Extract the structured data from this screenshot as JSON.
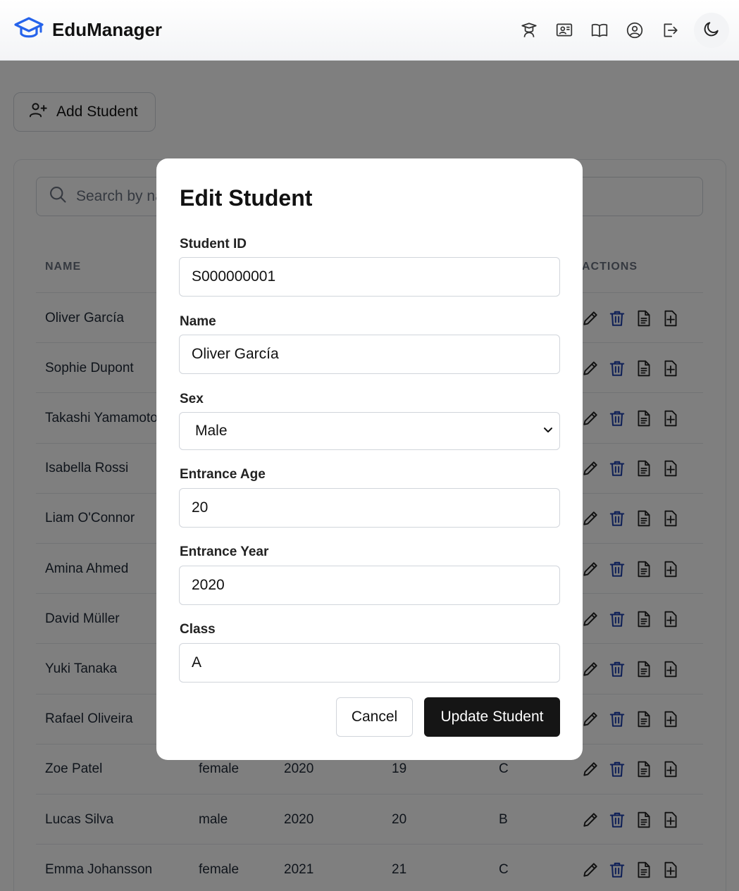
{
  "app": {
    "title": "EduManager"
  },
  "colors": {
    "brand": "#2563eb",
    "delete": "#1e40af"
  },
  "nav": {
    "icons": [
      "graduation-icon",
      "classroom-icon",
      "book-icon",
      "user-circle-icon",
      "logout-icon"
    ],
    "theme_icon": "moon-icon"
  },
  "toolbar": {
    "add_student_label": "Add Student"
  },
  "search": {
    "placeholder": "Search by na"
  },
  "table": {
    "headers": {
      "name": "NAME",
      "actions": "ACTIONS"
    },
    "rows": [
      {
        "name": "Oliver García",
        "sex": "",
        "year": "",
        "age": "",
        "class": ""
      },
      {
        "name": "Sophie Dupont",
        "sex": "",
        "year": "",
        "age": "",
        "class": ""
      },
      {
        "name": "Takashi Yamamoto",
        "sex": "",
        "year": "",
        "age": "",
        "class": ""
      },
      {
        "name": "Isabella Rossi",
        "sex": "",
        "year": "",
        "age": "",
        "class": ""
      },
      {
        "name": "Liam O'Connor",
        "sex": "",
        "year": "",
        "age": "",
        "class": ""
      },
      {
        "name": "Amina Ahmed",
        "sex": "",
        "year": "",
        "age": "",
        "class": ""
      },
      {
        "name": "David Müller",
        "sex": "",
        "year": "",
        "age": "",
        "class": ""
      },
      {
        "name": "Yuki Tanaka",
        "sex": "",
        "year": "",
        "age": "",
        "class": ""
      },
      {
        "name": "Rafael Oliveira",
        "sex": "",
        "year": "",
        "age": "",
        "class": ""
      },
      {
        "name": "Zoe Patel",
        "sex": "female",
        "year": "2020",
        "age": "19",
        "class": "C"
      },
      {
        "name": "Lucas Silva",
        "sex": "male",
        "year": "2020",
        "age": "20",
        "class": "B"
      },
      {
        "name": "Emma Johansson",
        "sex": "female",
        "year": "2021",
        "age": "21",
        "class": "C"
      }
    ]
  },
  "modal": {
    "title": "Edit Student",
    "fields": {
      "student_id": {
        "label": "Student ID",
        "value": "S000000001"
      },
      "name": {
        "label": "Name",
        "value": "Oliver García"
      },
      "sex": {
        "label": "Sex",
        "value": "Male"
      },
      "entrance_age": {
        "label": "Entrance Age",
        "value": "20"
      },
      "entrance_year": {
        "label": "Entrance Year",
        "value": "2020"
      },
      "class": {
        "label": "Class",
        "value": "A"
      }
    },
    "cancel_label": "Cancel",
    "submit_label": "Update Student"
  }
}
